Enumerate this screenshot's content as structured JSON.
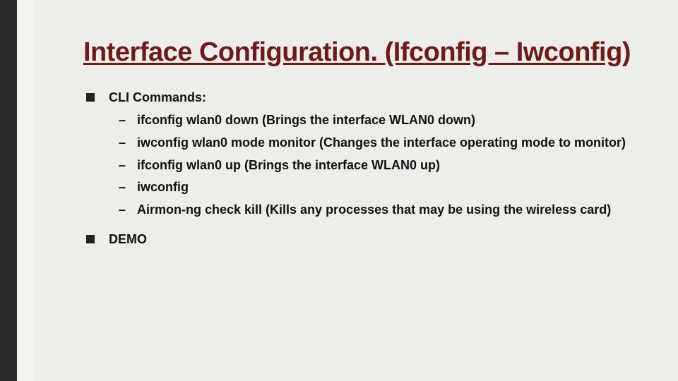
{
  "title": "Interface Configuration. (Ifconfig – Iwconfig)",
  "bullets": {
    "b0": {
      "label": "CLI Commands:",
      "sub": [
        "ifconfig wlan0 down (Brings the interface WLAN0 down)",
        "iwconfig wlan0 mode monitor (Changes the interface operating mode to monitor)",
        "ifconfig wlan0 up (Brings the interface WLAN0 up)",
        "iwconfig",
        "Airmon-ng check kill (Kills any processes that may be using the wireless card)"
      ]
    },
    "b1": {
      "label": "DEMO"
    }
  }
}
